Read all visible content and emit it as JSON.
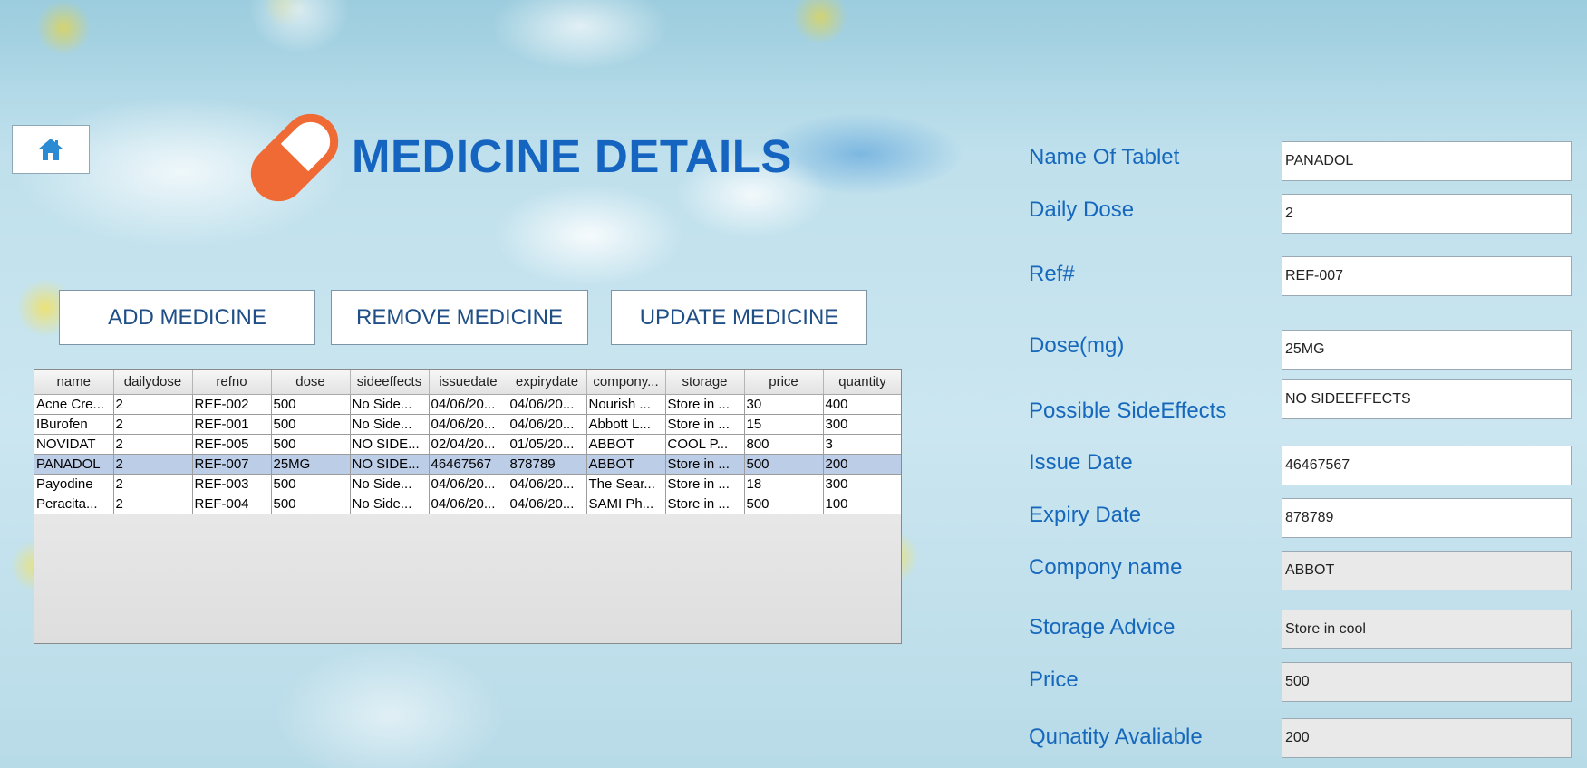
{
  "header": {
    "title": "MEDICINE DETAILS",
    "home_icon": "home-icon",
    "logo_icon": "capsule-icon",
    "accent_color": "#1565c0",
    "capsule_color": "#f06a35"
  },
  "actions": {
    "add": "ADD MEDICINE",
    "remove": "REMOVE MEDICINE",
    "update": "UPDATE MEDICINE"
  },
  "table": {
    "columns": [
      "name",
      "dailydose",
      "refno",
      "dose",
      "sideeffects",
      "issuedate",
      "expirydate",
      "compony...",
      "storage",
      "price",
      "quantity"
    ],
    "rows": [
      [
        "Acne Cre...",
        "2",
        "REF-002",
        "500",
        "No Side...",
        "04/06/20...",
        "04/06/20...",
        "Nourish ...",
        "Store in ...",
        "30",
        "400"
      ],
      [
        "IBurofen",
        "2",
        "REF-001",
        "500",
        "No Side...",
        "04/06/20...",
        "04/06/20...",
        "Abbott L...",
        "Store in ...",
        "15",
        "300"
      ],
      [
        "NOVIDAT",
        "2",
        "REF-005",
        "500",
        "NO SIDE...",
        "02/04/20...",
        "01/05/20...",
        "ABBOT",
        "COOL P...",
        "800",
        "3"
      ],
      [
        "PANADOL",
        "2",
        "REF-007",
        "25MG",
        "NO SIDE...",
        "46467567",
        "878789",
        "ABBOT",
        "Store in ...",
        "500",
        "200"
      ],
      [
        "Payodine",
        "2",
        "REF-003",
        "500",
        "No Side...",
        "04/06/20...",
        "04/06/20...",
        "The Sear...",
        "Store in ...",
        "18",
        "300"
      ],
      [
        "Peracita...",
        "2",
        "REF-004",
        "500",
        "No Side...",
        "04/06/20...",
        "04/06/20...",
        "SAMI Ph...",
        "Store in ...",
        "500",
        "100"
      ]
    ],
    "selected_row": 3
  },
  "form": {
    "fields": [
      {
        "label": "Name Of Tablet",
        "value": "PANADOL"
      },
      {
        "label": "Daily Dose",
        "value": "2"
      },
      {
        "label": "Ref#",
        "value": "REF-007"
      },
      {
        "label": "Dose(mg)",
        "value": "25MG"
      },
      {
        "label": "Possible SideEffects",
        "value": "NO SIDEEFFECTS"
      },
      {
        "label": "Issue Date",
        "value": "46467567"
      },
      {
        "label": "Expiry Date",
        "value": "878789"
      },
      {
        "label": "Compony name",
        "value": "ABBOT"
      },
      {
        "label": "Storage Advice",
        "value": "Store in cool"
      },
      {
        "label": "Price",
        "value": "500"
      },
      {
        "label": "Qunatity Avaliable",
        "value": "200"
      }
    ]
  }
}
